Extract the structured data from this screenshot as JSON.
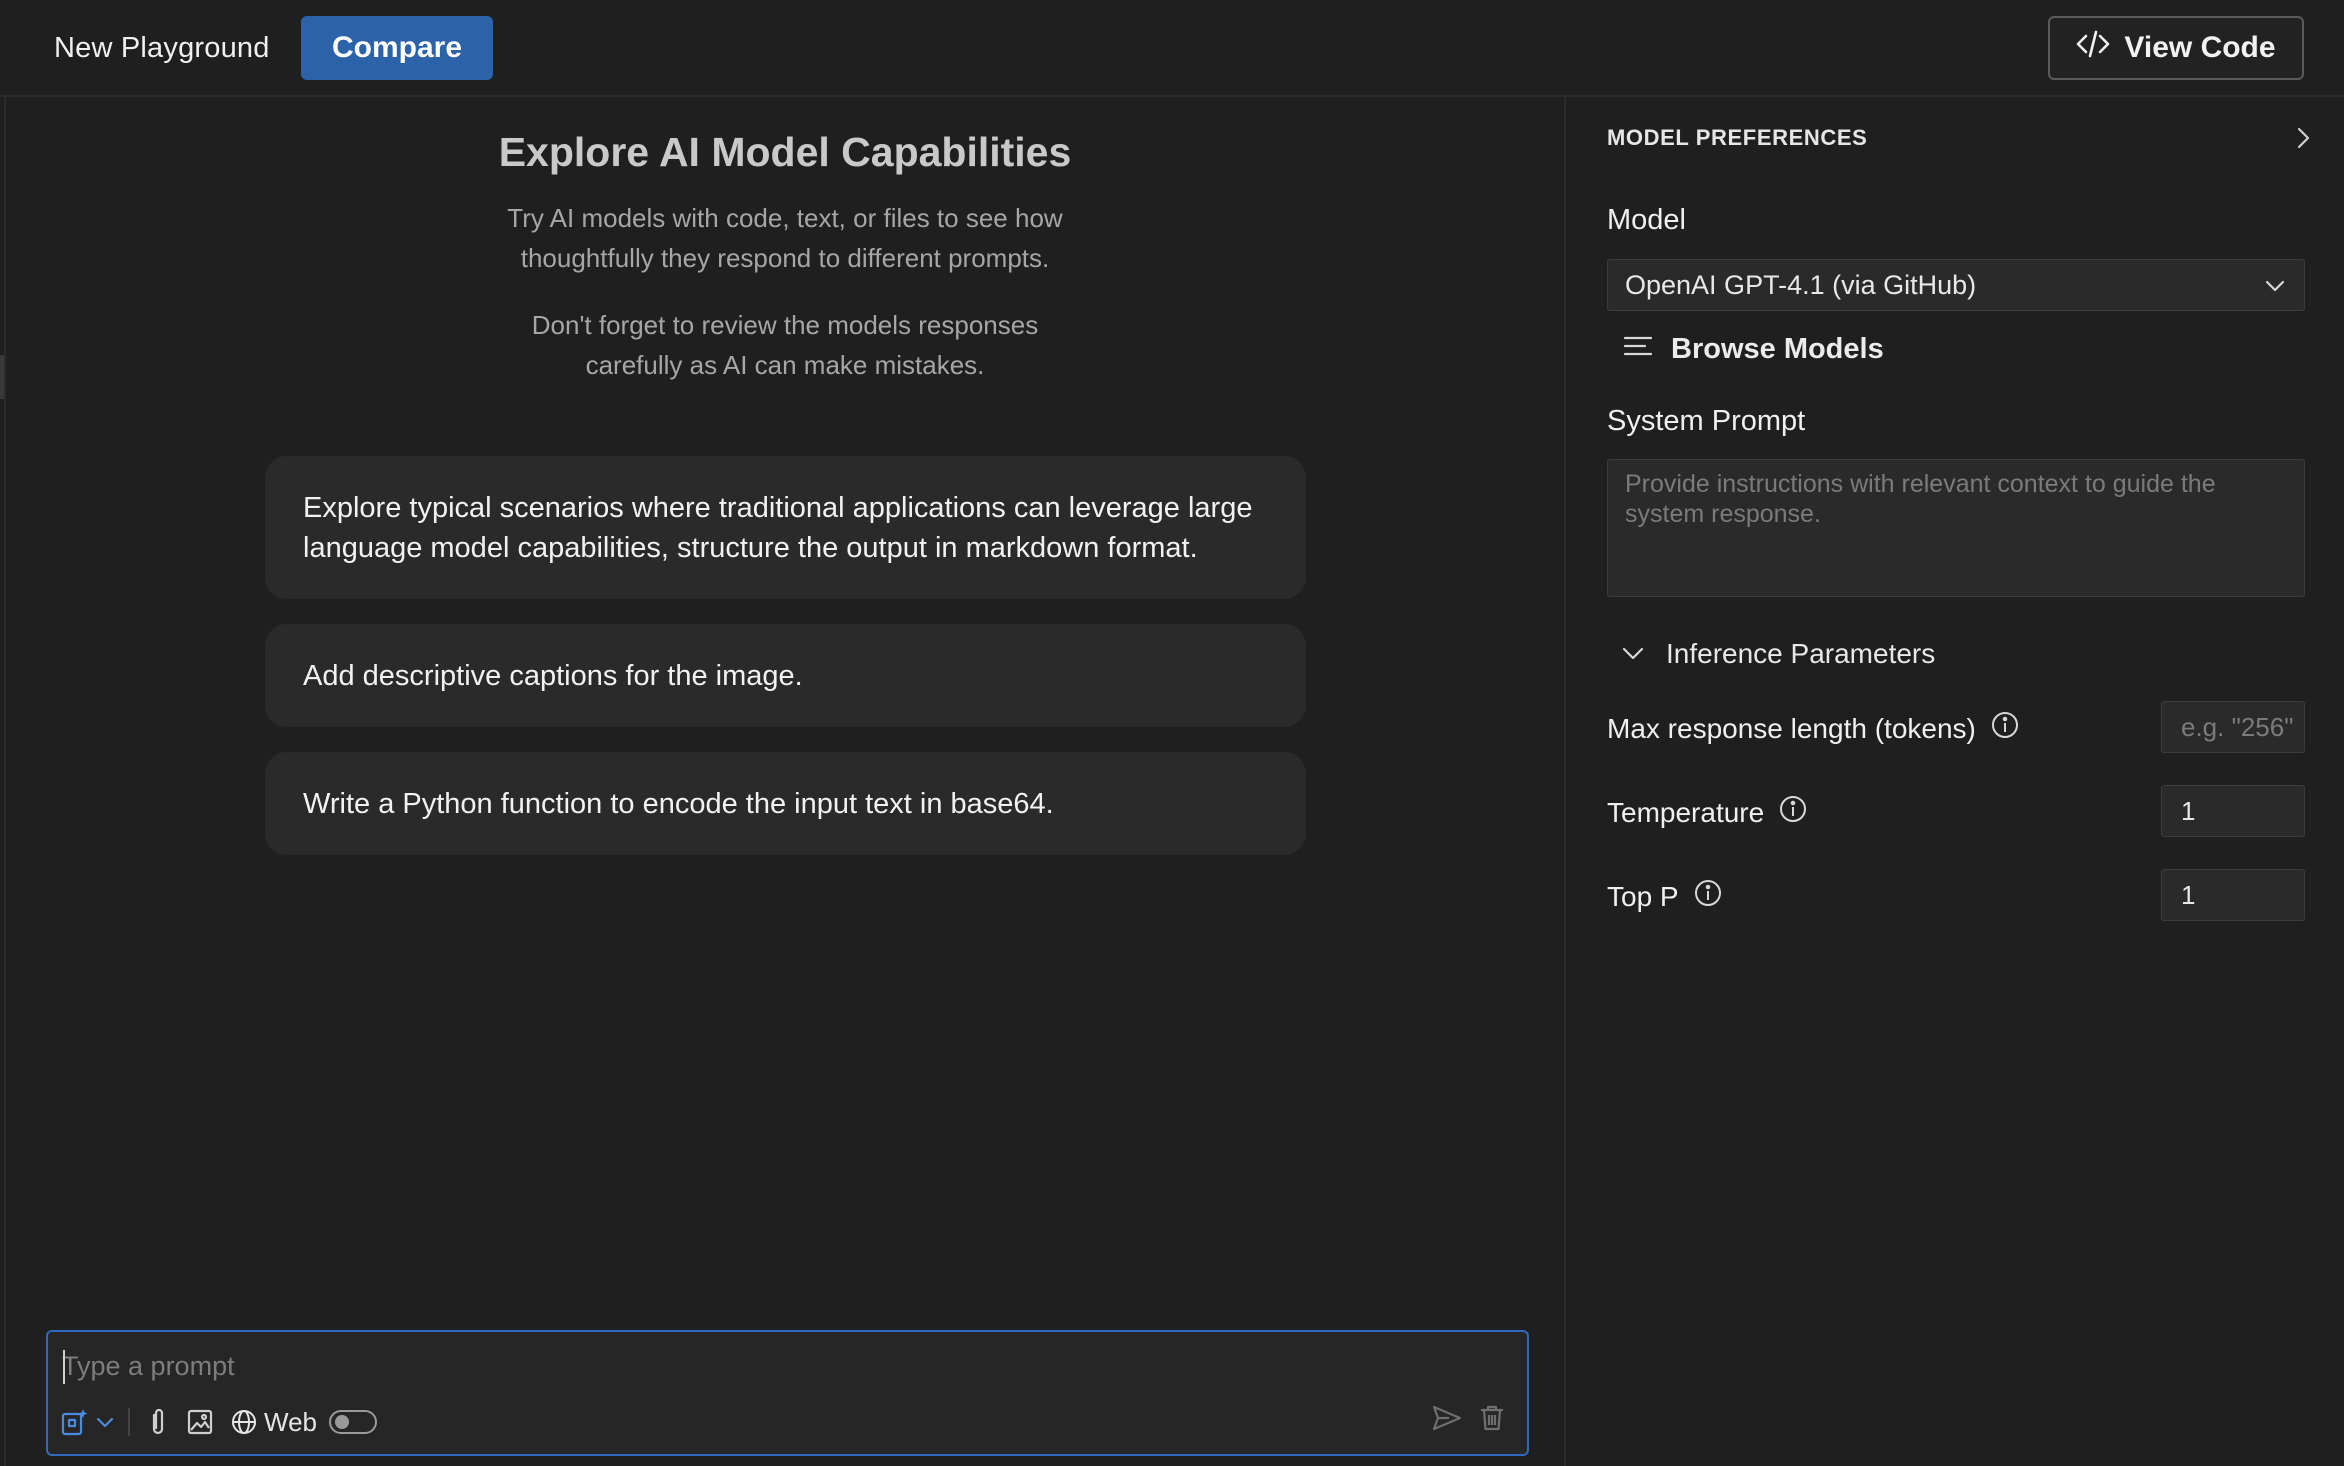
{
  "header": {
    "tab_label": "New Playground",
    "compare_label": "Compare",
    "view_code_label": "View Code"
  },
  "main": {
    "title": "Explore AI Model Capabilities",
    "subtitle_line1": "Try AI models with code, text, or files to see how",
    "subtitle_line2": "thoughtfully they respond to different prompts.",
    "warning_line1": "Don't forget to review the models responses",
    "warning_line2": "carefully as AI can make mistakes.",
    "suggestions": [
      "Explore typical scenarios where traditional applications can leverage large language model capabilities, structure the output in markdown format.",
      "Add descriptive captions for the image.",
      "Write a Python function to encode the input text in base64."
    ]
  },
  "prompt": {
    "placeholder": "Type a prompt",
    "web_label": "Web",
    "web_enabled": false
  },
  "panel": {
    "title": "MODEL PREFERENCES",
    "model_label": "Model",
    "model_selected": "OpenAI GPT-4.1 (via GitHub)",
    "browse_label": "Browse Models",
    "system_prompt_label": "System Prompt",
    "system_prompt_placeholder": "Provide instructions with relevant context to guide the system response.",
    "inference_label": "Inference Parameters",
    "params": [
      {
        "label": "Max response length (tokens)",
        "value": "",
        "placeholder": "e.g. \"256\""
      },
      {
        "label": "Temperature",
        "value": "1",
        "placeholder": ""
      },
      {
        "label": "Top P",
        "value": "1",
        "placeholder": ""
      }
    ]
  },
  "colors": {
    "accent": "#2c62a8",
    "focus_border": "#2f6ac0",
    "background": "#1f1f1f",
    "card": "#2a2a2a"
  }
}
